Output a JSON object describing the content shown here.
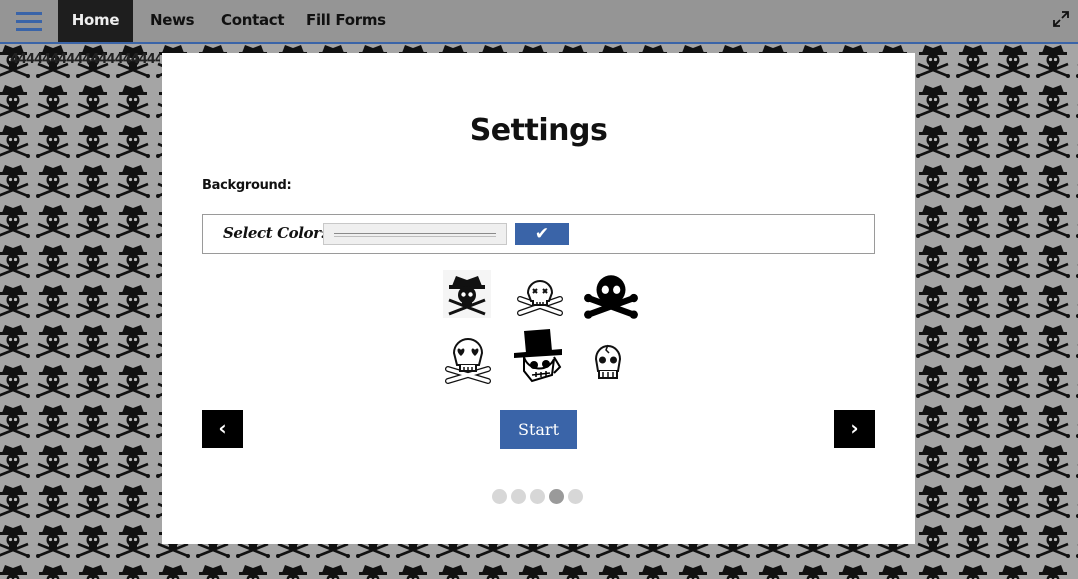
{
  "nav": {
    "items": [
      {
        "label": "Home",
        "active": true
      },
      {
        "label": "News"
      },
      {
        "label": "Contact"
      },
      {
        "label": "Fill Forms"
      }
    ],
    "menu_icon": "hamburger-menu-icon",
    "expand_icon": "expand-icon"
  },
  "background_text": "4444444444444444444",
  "modal": {
    "title": "Settings",
    "background_label": "Background:",
    "select_color_label": "Select Color:",
    "confirm_label": "✔",
    "skull_options": [
      "pirate-skull-icon",
      "skull-crossbones-outline-icon",
      "skull-crossbones-solid-icon",
      "skull-crossbones-heart-eyes-icon",
      "top-hat-skull-icon",
      "small-skull-icon"
    ],
    "prev_label": "‹",
    "next_label": "›",
    "start_label": "Start",
    "pagination": {
      "count": 5,
      "active_index": 3
    }
  },
  "colors": {
    "accent": "#3a64a8",
    "nav_bg": "#959595",
    "active_nav": "#1e1e1e",
    "modal_bg": "#ffffff"
  }
}
